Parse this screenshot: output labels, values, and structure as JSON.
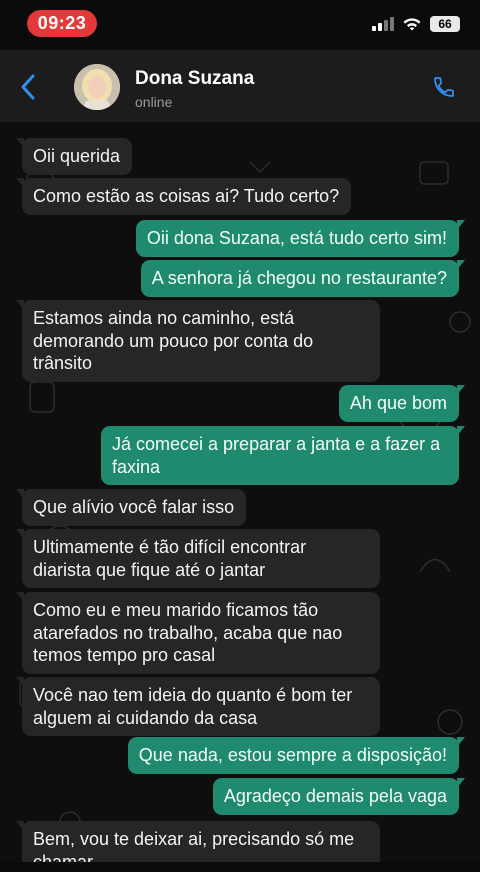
{
  "status_bar": {
    "time": "09:23",
    "battery": "66"
  },
  "header": {
    "contact_name": "Dona Suzana",
    "status": "online"
  },
  "colors": {
    "accent": "#2f8ff0",
    "incoming": "#262628",
    "outgoing": "#1f8a6e",
    "time_pill": "#e5383b"
  },
  "icons": {
    "back": "chevron-left-icon",
    "call": "phone-icon"
  },
  "messages": [
    {
      "dir": "in",
      "text": "Oii querida"
    },
    {
      "dir": "in",
      "text": "Como estão as coisas ai? Tudo certo?"
    },
    {
      "dir": "out",
      "text": "Oii dona Suzana, está tudo certo sim!"
    },
    {
      "dir": "out",
      "text": "A senhora já chegou no restaurante?"
    },
    {
      "dir": "in",
      "text": "Estamos ainda no caminho, está demorando um pouco por conta do trânsito"
    },
    {
      "dir": "out",
      "text": "Ah que bom"
    },
    {
      "dir": "out",
      "text": "Já comecei a preparar a janta e a fazer a faxina"
    },
    {
      "dir": "in",
      "text": "Que alívio você falar isso"
    },
    {
      "dir": "in",
      "text": "Ultimamente é tão difícil encontrar diarista que fique até o jantar"
    },
    {
      "dir": "in",
      "text": "Como eu e meu marido ficamos tão atarefados no trabalho, acaba que nao temos tempo pro casal"
    },
    {
      "dir": "in",
      "text": "Você nao tem ideia do quanto é bom ter alguem ai cuidando da casa"
    },
    {
      "dir": "out",
      "text": "Que nada, estou sempre a disposição!"
    },
    {
      "dir": "out",
      "text": "Agradeço demais pela vaga"
    },
    {
      "dir": "in",
      "text": "Bem, vou te deixar ai, precisando só me chamar"
    }
  ]
}
